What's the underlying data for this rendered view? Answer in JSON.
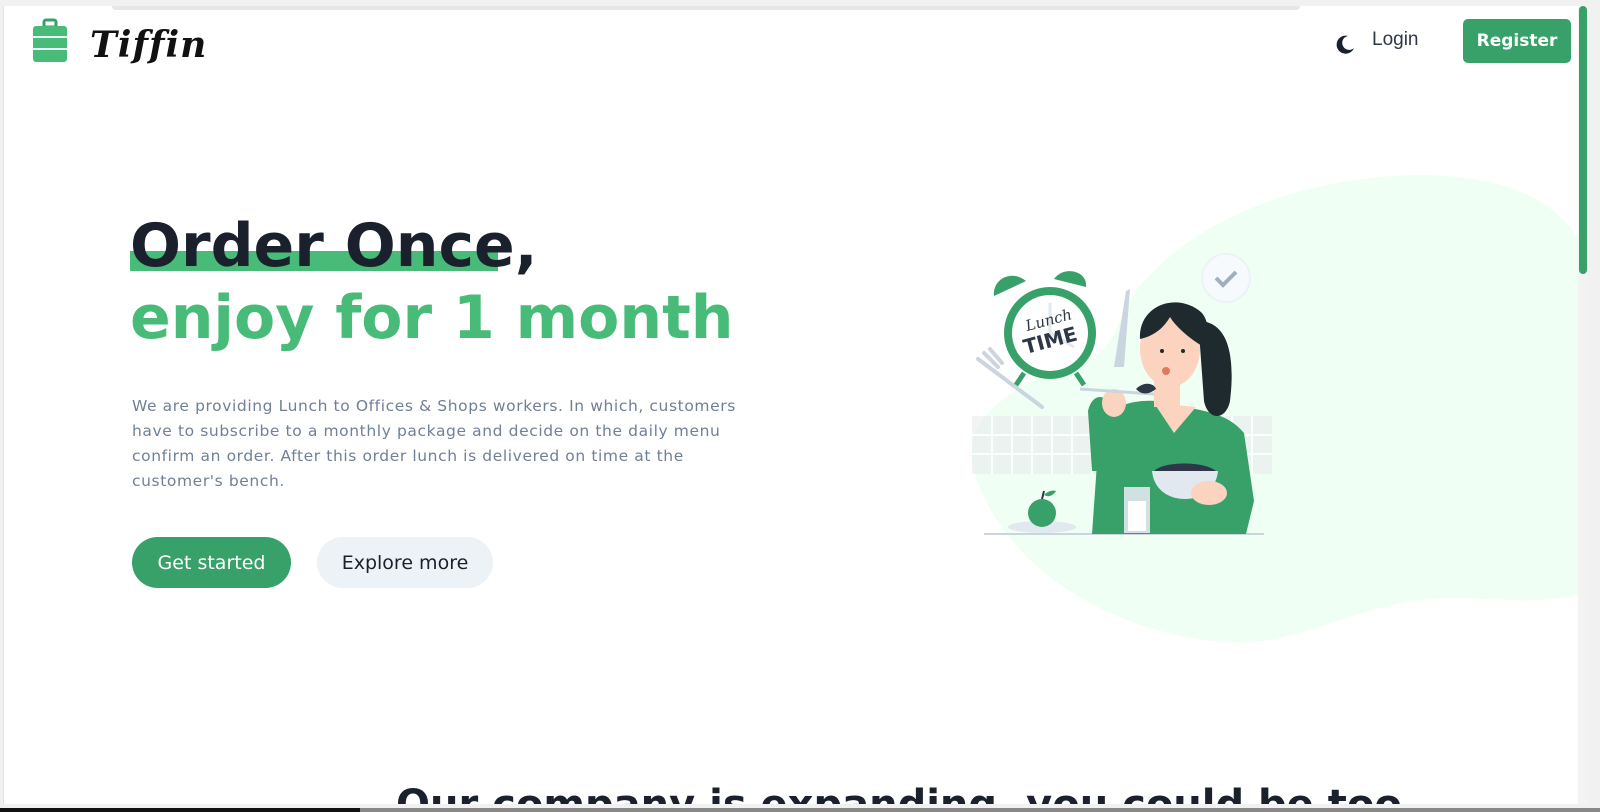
{
  "header": {
    "brand": "Tiffin",
    "login_label": "Login",
    "register_label": "Register",
    "theme_toggle_icon": "moon-icon"
  },
  "hero": {
    "title_line1": "Order Once,",
    "title_line2": "enjoy for 1 month",
    "description": "We are providing Lunch to Offices & Shops workers. In which, customers have to subscribe to a monthly package and decide on the daily menu confirm an order. After this order lunch is delivered on time at the customer's bench.",
    "primary_button": "Get started",
    "secondary_button": "Explore more",
    "illustration_clock_text_1": "Lunch",
    "illustration_clock_text_2": "TIME"
  },
  "next_section": {
    "heading": "Our company is expanding, you could be too."
  },
  "colors": {
    "accent": "#38a169",
    "accent_light": "#48bb78",
    "blob": "#f0fff4",
    "text_dark": "#1a202c",
    "text_muted": "#718096"
  }
}
